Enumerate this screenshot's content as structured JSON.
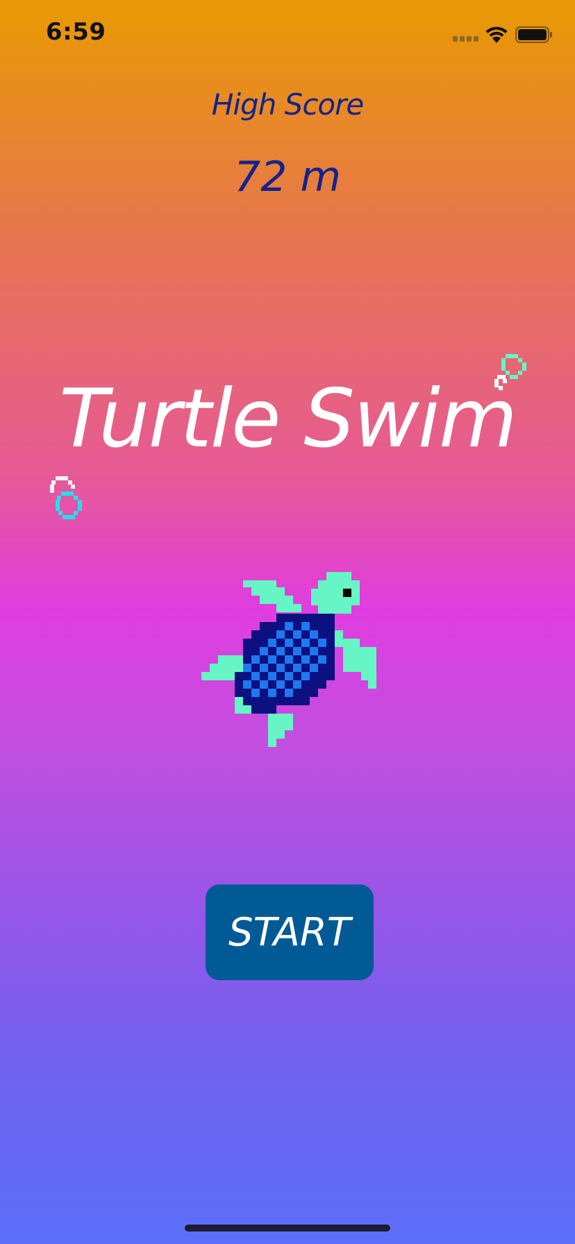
{
  "status_bar": {
    "time": "6:59",
    "icons": [
      "cellular-signal-icon",
      "wifi-icon",
      "battery-icon"
    ]
  },
  "high_score": {
    "label": "High Score",
    "value": "72 m"
  },
  "title": "Turtle Swim",
  "start_button": {
    "label": "START"
  },
  "sprites": [
    "turtle-sprite",
    "bubble-icon",
    "bubble-icon"
  ],
  "colors": {
    "gradient_top": "#e89a02",
    "gradient_middle": "#e03de0",
    "gradient_bottom": "#5c6ffb",
    "score_text": "#13238c",
    "title_text": "#ffffff",
    "button_bg": "#005a95",
    "turtle_body": "#66f5c4",
    "turtle_shell_dark": "#0c1080",
    "turtle_shell_light": "#1e78f0"
  }
}
